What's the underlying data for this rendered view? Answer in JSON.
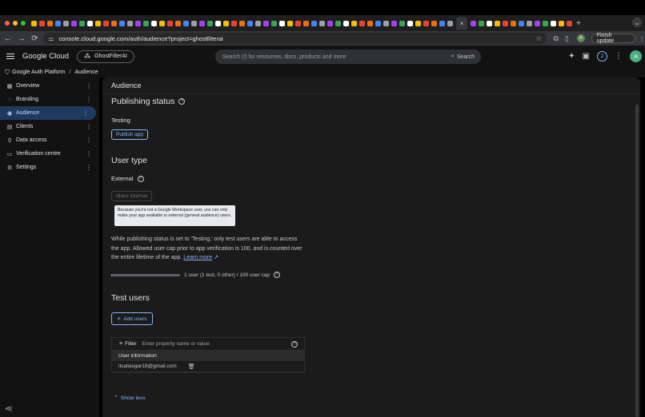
{
  "browser": {
    "url": "console.cloud.google.com/auth/audience?project=ghostfilterai",
    "finish_update": "Finish update",
    "profile_initial": "A",
    "traffic_colors": [
      "#ff5f57",
      "#febc2e",
      "#28c840"
    ]
  },
  "header": {
    "logo": "Google Cloud",
    "project": "GhostFilterAI",
    "search_placeholder": "Search (/) for resources, docs, products and more",
    "search_button": "Search",
    "notification_count": "2",
    "avatar_initial": "A"
  },
  "breadcrumb": {
    "root": "Google Auth Platform",
    "current": "Audience"
  },
  "sidebar": {
    "items": [
      {
        "label": "Overview",
        "icon": "overview-icon",
        "glyph": "▦"
      },
      {
        "label": "Branding",
        "icon": "palette-icon",
        "glyph": "◌"
      },
      {
        "label": "Audience",
        "icon": "person-icon",
        "glyph": "◉"
      },
      {
        "label": "Clients",
        "icon": "clients-icon",
        "glyph": "▤"
      },
      {
        "label": "Data access",
        "icon": "data-access-icon",
        "glyph": "⚲"
      },
      {
        "label": "Verification centre",
        "icon": "verification-icon",
        "glyph": "▭"
      },
      {
        "label": "Settings",
        "icon": "gear-icon",
        "glyph": "⚙"
      }
    ],
    "active_index": 2
  },
  "main": {
    "title": "Audience",
    "publishing": {
      "heading": "Publishing status",
      "status": "Testing",
      "button": "Publish app"
    },
    "user_type": {
      "heading": "User type",
      "value": "External",
      "button": "Make internal",
      "tooltip": "Because you're not a Google Workspace user, you can only make your app available to external (general audience) users."
    },
    "description": "While publishing status is set to 'Testing,' only test users are able to access the app. Allowed user cap prior to app verification is 100, and is counted over the entire lifetime of the app.",
    "learn_more": "Learn more",
    "user_cap": {
      "text": "1 user (1 test, 0 other) / 100 user cap",
      "fraction": 0.01
    },
    "test_users": {
      "heading": "Test users",
      "add_button": "Add users",
      "filter_label": "Filter",
      "filter_placeholder": "Enter property name or value",
      "column": "User information",
      "rows": [
        "itsaliasgar18@gmail.com"
      ]
    },
    "show_less": "Show less"
  },
  "colors": {
    "accent": "#8ab4f8",
    "active_nav_bg": "#1e3a5f"
  }
}
